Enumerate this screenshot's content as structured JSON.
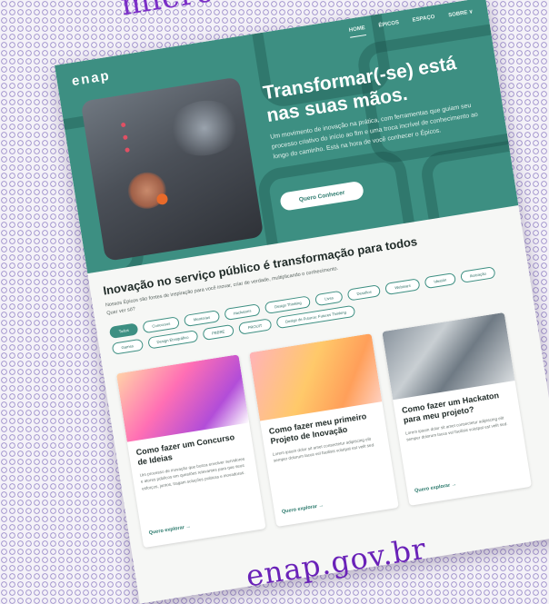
{
  "overlay": {
    "top_text": "microlearning",
    "bottom_text": "enap.gov.br"
  },
  "site": {
    "logo": "enap",
    "nav": [
      "Home",
      "Épicos",
      "Espaço",
      "Sobre ∨"
    ]
  },
  "hero": {
    "title": "Transformar(-se) está nas suas mãos.",
    "description": "Um movimento de inovação na prática, com ferramentas que guiam seu processo criativo do início ao fim e uma troca incrível de conhecimento ao longo do caminho. Está na hora de você conhecer o Épicos.",
    "button": "Quero Conhecer"
  },
  "section": {
    "title": "Inovação no serviço público é transformação para todos",
    "description": "Nossos Épicos são fontes de inspiração para você inovar, criar de verdade, multiplicando o conhecimento. Quer ver só?"
  },
  "tags": [
    "Todos",
    "Concursos",
    "Mentorias",
    "Hackatons",
    "Design Thinking",
    "Lives",
    "Desafios",
    "Webinars",
    "Ideatón",
    "Ilustração",
    "Games",
    "Design Etnográfico",
    "PBBRE",
    "FROUIT",
    "Design de Futuros: Futures Thinking"
  ],
  "cards": [
    {
      "title": "Como fazer um Concurso de Ideias",
      "description": "Um processo de inovação que busca envolver servidores e atores públicos em questões relevantes para que seus esforços, juntos, tragam soluções práticas e inovadoras.",
      "link": "Quero explorar →"
    },
    {
      "title": "Como fazer meu primeiro Projeto de Inovação",
      "description": "Lorem ipsum dolor sit amet consectetur adipiscing elit semper dolorum lacus vel facilisis volutpat est velit sed.",
      "link": "Quero explorar →"
    },
    {
      "title": "Como fazer um Hackaton para meu projeto?",
      "description": "Lorem ipsum dolor sit amet consectetur adipiscing elit semper dolorum lacus vel facilisis volutpat est velit sed.",
      "link": "Quero explorar →"
    }
  ],
  "colors": {
    "brand": "#3d8f82",
    "accent_purple": "#7b2fc7"
  }
}
